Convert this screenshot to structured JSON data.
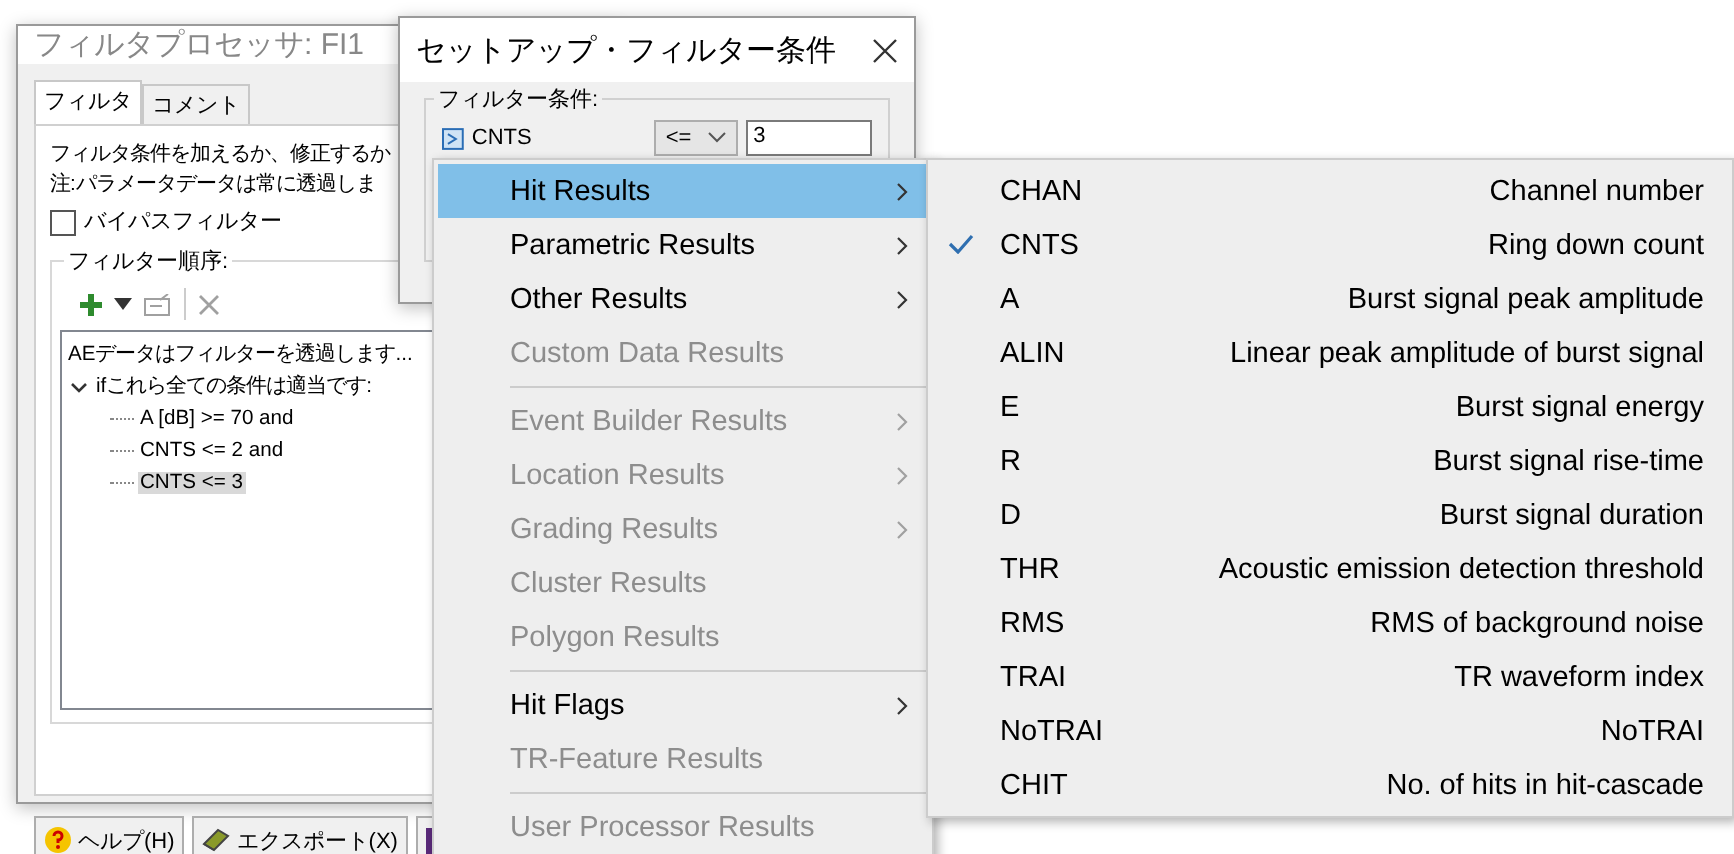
{
  "filter_window": {
    "title": "フィルタプロセッサ: FI1",
    "tabs": [
      {
        "label": "フィルタ",
        "selected": true
      },
      {
        "label": "コメント",
        "selected": false
      }
    ],
    "instructions": [
      "フィルタ条件を加えるか、修正するか",
      "注:パラメータデータは常に透過しま"
    ],
    "bypass": {
      "label": "バイパスフィルター",
      "checked": false
    },
    "sequence_label": "フィルター順序:",
    "toolbar": [
      {
        "kind": "add",
        "disabled": false
      },
      {
        "kind": "dropdown",
        "disabled": false
      },
      {
        "kind": "edit",
        "disabled": true
      },
      {
        "kind": "delete",
        "disabled": true
      }
    ],
    "tree_root": "AEデータはフィルターを透過します...",
    "tree": [
      {
        "label": "ifこれら全ての条件は適当です:",
        "expanded": true,
        "selected": false,
        "children": [
          {
            "label": "A [dB] >= 70 and",
            "selected": false
          },
          {
            "label": "CNTS <= 2 and",
            "selected": false
          },
          {
            "label": "CNTS <= 3",
            "selected": true
          }
        ]
      }
    ],
    "buttons": [
      {
        "label": "ヘルプ(H)"
      },
      {
        "label": "エクスポート(X)"
      }
    ]
  },
  "setup_dialog": {
    "title": "セットアップ・フィルター条件",
    "group_label": "フィルター条件:",
    "parameter": "CNTS",
    "operator": "<=",
    "value": "3"
  },
  "menu": [
    {
      "kind": "item",
      "label": "Hit Results",
      "disabled": false,
      "submenu": true,
      "selected": true
    },
    {
      "kind": "item",
      "label": "Parametric Results",
      "disabled": false,
      "submenu": true,
      "selected": false
    },
    {
      "kind": "item",
      "label": "Other Results",
      "disabled": false,
      "submenu": true,
      "selected": false
    },
    {
      "kind": "item",
      "label": "Custom Data Results",
      "disabled": true,
      "submenu": false,
      "selected": false
    },
    {
      "kind": "separator"
    },
    {
      "kind": "item",
      "label": "Event Builder Results",
      "disabled": true,
      "submenu": true,
      "selected": false
    },
    {
      "kind": "item",
      "label": "Location Results",
      "disabled": true,
      "submenu": true,
      "selected": false
    },
    {
      "kind": "item",
      "label": "Grading Results",
      "disabled": true,
      "submenu": true,
      "selected": false
    },
    {
      "kind": "item",
      "label": "Cluster Results",
      "disabled": true,
      "submenu": false,
      "selected": false
    },
    {
      "kind": "item",
      "label": "Polygon Results",
      "disabled": true,
      "submenu": false,
      "selected": false
    },
    {
      "kind": "separator"
    },
    {
      "kind": "item",
      "label": "Hit Flags",
      "disabled": false,
      "submenu": true,
      "selected": false
    },
    {
      "kind": "item",
      "label": "TR-Feature Results",
      "disabled": true,
      "submenu": false,
      "selected": false
    },
    {
      "kind": "separator"
    },
    {
      "kind": "item",
      "label": "User Processor Results",
      "disabled": true,
      "submenu": false,
      "selected": false
    }
  ],
  "submenu": [
    {
      "code": "CHAN",
      "description": "Channel number",
      "checked": false
    },
    {
      "code": "CNTS",
      "description": "Ring down count",
      "checked": true
    },
    {
      "code": "A",
      "description": "Burst signal peak amplitude",
      "checked": false
    },
    {
      "code": "ALIN",
      "description": "Linear peak amplitude of burst signal",
      "checked": false
    },
    {
      "code": "E",
      "description": "Burst signal energy",
      "checked": false
    },
    {
      "code": "R",
      "description": "Burst signal rise-time",
      "checked": false
    },
    {
      "code": "D",
      "description": "Burst signal duration",
      "checked": false
    },
    {
      "code": "THR",
      "description": "Acoustic emission detection threshold",
      "checked": false
    },
    {
      "code": "RMS",
      "description": "RMS of background noise",
      "checked": false
    },
    {
      "code": "TRAI",
      "description": "TR waveform index",
      "checked": false
    },
    {
      "code": "NoTRAI",
      "description": "NoTRAI",
      "checked": false
    },
    {
      "code": "CHIT",
      "description": "No. of hits in hit-cascade",
      "checked": false
    }
  ]
}
